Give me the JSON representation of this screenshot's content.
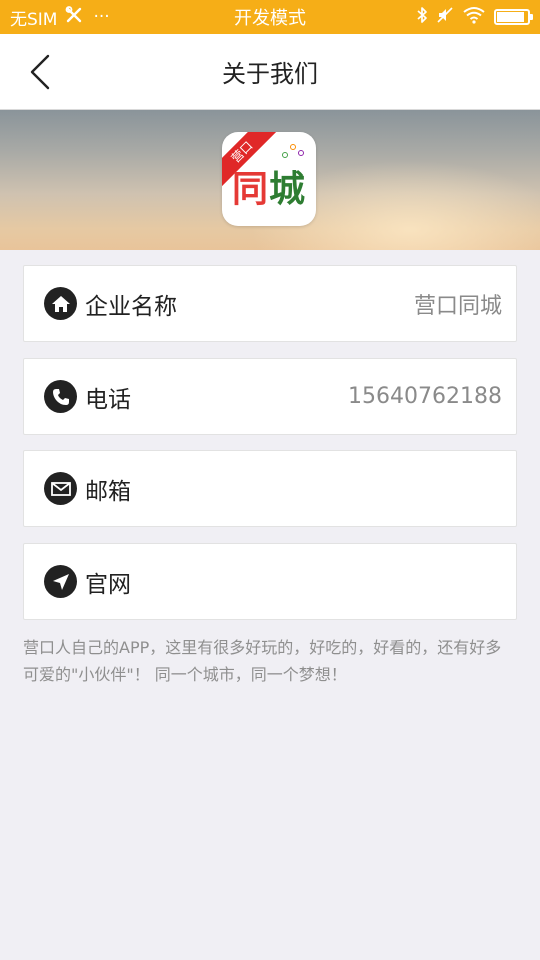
{
  "status_bar": {
    "carrier": "无SIM",
    "more": "···",
    "mode": "开发模式",
    "battery_level": 0.9
  },
  "nav": {
    "title": "关于我们"
  },
  "banner": {
    "logo_ribbon": "营口",
    "logo_text_1": "同",
    "logo_text_2": "城"
  },
  "info_items": [
    {
      "icon": "home-icon",
      "label": "企业名称",
      "value": "营口同城"
    },
    {
      "icon": "phone-icon",
      "label": "电话",
      "value": "15640762188"
    },
    {
      "icon": "mail-icon",
      "label": "邮箱",
      "value": ""
    },
    {
      "icon": "location-arrow-icon",
      "label": "官网",
      "value": ""
    }
  ],
  "description": "营口人自己的APP，这里有很多好玩的，好吃的，好看的，还有好多可爱的\"小伙伴\"！ 同一个城市，同一个梦想！",
  "colors": {
    "status_bar": "#f6ae17",
    "background": "#f0eff4",
    "icon_bg": "#222222"
  }
}
